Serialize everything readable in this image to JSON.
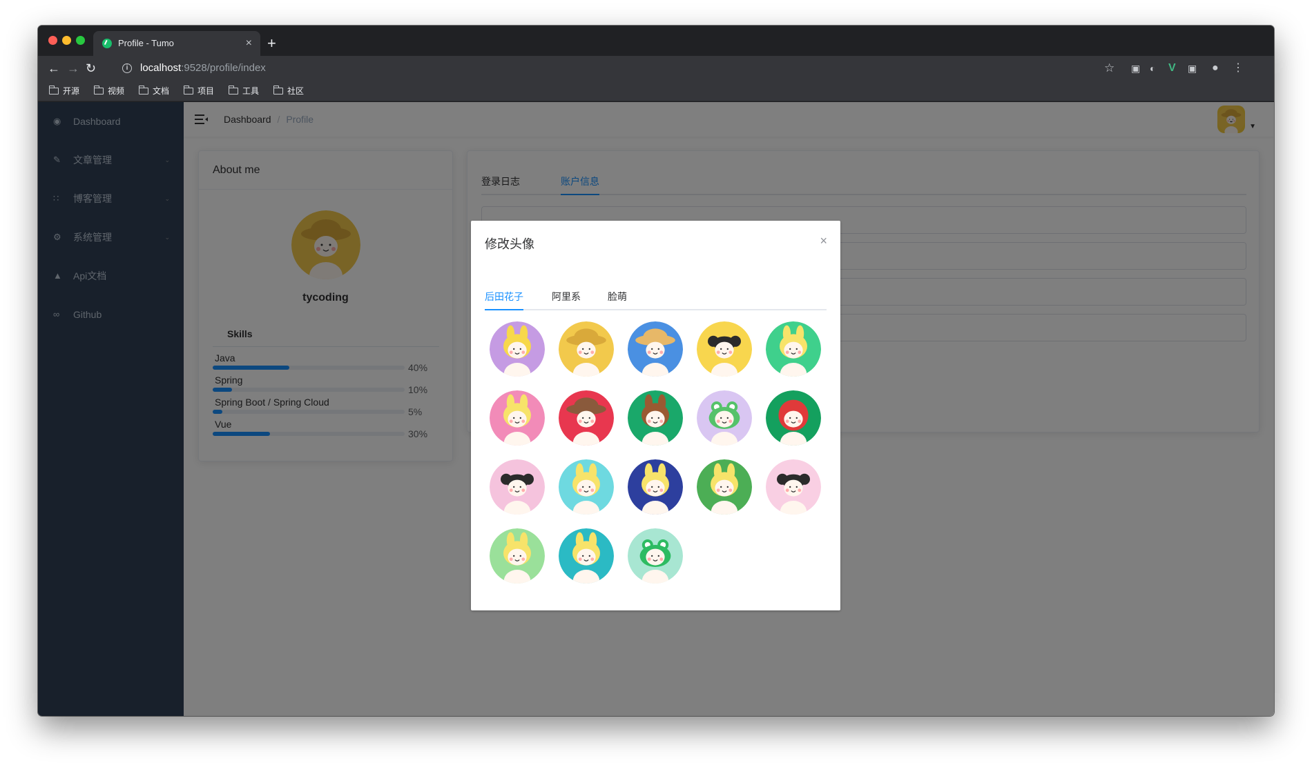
{
  "browser": {
    "tab_title": "Profile - Tumo",
    "tab_close": "×",
    "new_tab": "+",
    "url_host": "localhost",
    "url_path": ":9528/profile/index",
    "bookmarks": [
      "开源",
      "视频",
      "文档",
      "项目",
      "工具",
      "社区"
    ]
  },
  "sidebar": {
    "items": [
      {
        "label": "Dashboard",
        "icon": "dashboard-icon",
        "has_children": false
      },
      {
        "label": "文章管理",
        "icon": "edit-icon",
        "has_children": true
      },
      {
        "label": "博客管理",
        "icon": "grid-icon",
        "has_children": true
      },
      {
        "label": "系统管理",
        "icon": "gear-icon",
        "has_children": true
      },
      {
        "label": "Api文档",
        "icon": "tree-icon",
        "has_children": false
      },
      {
        "label": "Github",
        "icon": "link-icon",
        "has_children": false
      }
    ]
  },
  "navbar": {
    "breadcrumb": [
      "Dashboard",
      "Profile"
    ],
    "separator": "/"
  },
  "about": {
    "title": "About me",
    "username": "tycoding",
    "skills_title": "Skills",
    "skills": [
      {
        "name": "Java",
        "percent": 40,
        "label": "40%"
      },
      {
        "name": "Spring",
        "percent": 10,
        "label": "10%"
      },
      {
        "name": "Spring Boot / Spring Cloud",
        "percent": 5,
        "label": "5%"
      },
      {
        "name": "Vue",
        "percent": 30,
        "label": "30%"
      }
    ]
  },
  "account": {
    "tabs": [
      "登录日志",
      "账户信息"
    ],
    "active_tab": 1
  },
  "dialog": {
    "title": "修改头像",
    "close": "×",
    "tabs": [
      "后田花子",
      "阿里系",
      "脸萌"
    ],
    "active_tab": 0,
    "avatars": [
      {
        "bg": "#c59be3",
        "hair": "#f7d84a",
        "type": "bunny"
      },
      {
        "bg": "#f2c94c",
        "hair": "#d9a93a",
        "type": "hat"
      },
      {
        "bg": "#4a90e2",
        "hair": "#e7b868",
        "type": "hat"
      },
      {
        "bg": "#f8d64e",
        "hair": "#2b2b2b",
        "type": "pigtails"
      },
      {
        "bg": "#3fd08c",
        "hair": "#f7e36a",
        "type": "chick"
      },
      {
        "bg": "#f28bb8",
        "hair": "#f7e36a",
        "type": "chick"
      },
      {
        "bg": "#e8374f",
        "hair": "#8a5a3c",
        "type": "hat"
      },
      {
        "bg": "#1aa86a",
        "hair": "#9a5a32",
        "type": "bunny"
      },
      {
        "bg": "#d9c6f2",
        "hair": "#55c26a",
        "type": "frog"
      },
      {
        "bg": "#14a05e",
        "hair": "#e03a3a",
        "type": "hood"
      },
      {
        "bg": "#f5c3dd",
        "hair": "#2b2b2b",
        "type": "pigtails"
      },
      {
        "bg": "#6ed9e0",
        "hair": "#f7e36a",
        "type": "bunny"
      },
      {
        "bg": "#2d3f9e",
        "hair": "#f7e36a",
        "type": "bunny"
      },
      {
        "bg": "#4cae55",
        "hair": "#f7e36a",
        "type": "bunny"
      },
      {
        "bg": "#f9cfe3",
        "hair": "#2b2b2b",
        "type": "pigtails"
      },
      {
        "bg": "#9ae09a",
        "hair": "#f7e36a",
        "type": "bunny"
      },
      {
        "bg": "#2bbac4",
        "hair": "#f7e36a",
        "type": "bunny"
      },
      {
        "bg": "#a8e6d2",
        "hair": "#2dbb62",
        "type": "frog"
      }
    ]
  },
  "colors": {
    "sidebar_bg": "#304156",
    "primary": "#1890ff",
    "browser_bg": "#202124"
  }
}
